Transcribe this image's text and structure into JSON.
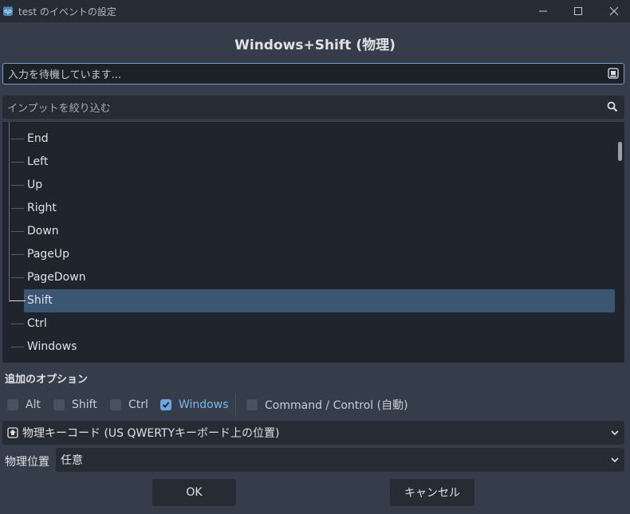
{
  "window": {
    "title": "test のイベントの設定",
    "minimize_icon": "minimize-icon",
    "maximize_icon": "maximize-icon",
    "close_icon": "close-icon"
  },
  "dialog": {
    "heading": "Windows+Shift (物理)"
  },
  "listen": {
    "placeholder": "入力を待機しています..."
  },
  "filter": {
    "placeholder": "インプットを絞り込む"
  },
  "tree": {
    "items": [
      {
        "label": "End",
        "selected": false
      },
      {
        "label": "Left",
        "selected": false
      },
      {
        "label": "Up",
        "selected": false
      },
      {
        "label": "Right",
        "selected": false
      },
      {
        "label": "Down",
        "selected": false
      },
      {
        "label": "PageUp",
        "selected": false
      },
      {
        "label": "PageDown",
        "selected": false
      },
      {
        "label": "Shift",
        "selected": true
      },
      {
        "label": "Ctrl",
        "selected": false
      },
      {
        "label": "Windows",
        "selected": false
      }
    ]
  },
  "options": {
    "heading": "追加のオプション",
    "modifiers": [
      {
        "label": "Alt",
        "checked": false
      },
      {
        "label": "Shift",
        "checked": false
      },
      {
        "label": "Ctrl",
        "checked": false
      },
      {
        "label": "Windows",
        "checked": true
      }
    ],
    "command": {
      "label": "Command / Control (自動)",
      "checked": false
    }
  },
  "keycode": {
    "selected": "物理キーコード (US QWERTYキーボード上の位置)"
  },
  "location": {
    "label": "物理位置",
    "selected": "任意"
  },
  "buttons": {
    "ok": "OK",
    "cancel": "キャンセル"
  },
  "colors": {
    "accent": "#6da5e0",
    "selection": "#3b5673",
    "background": "#363d4a"
  }
}
